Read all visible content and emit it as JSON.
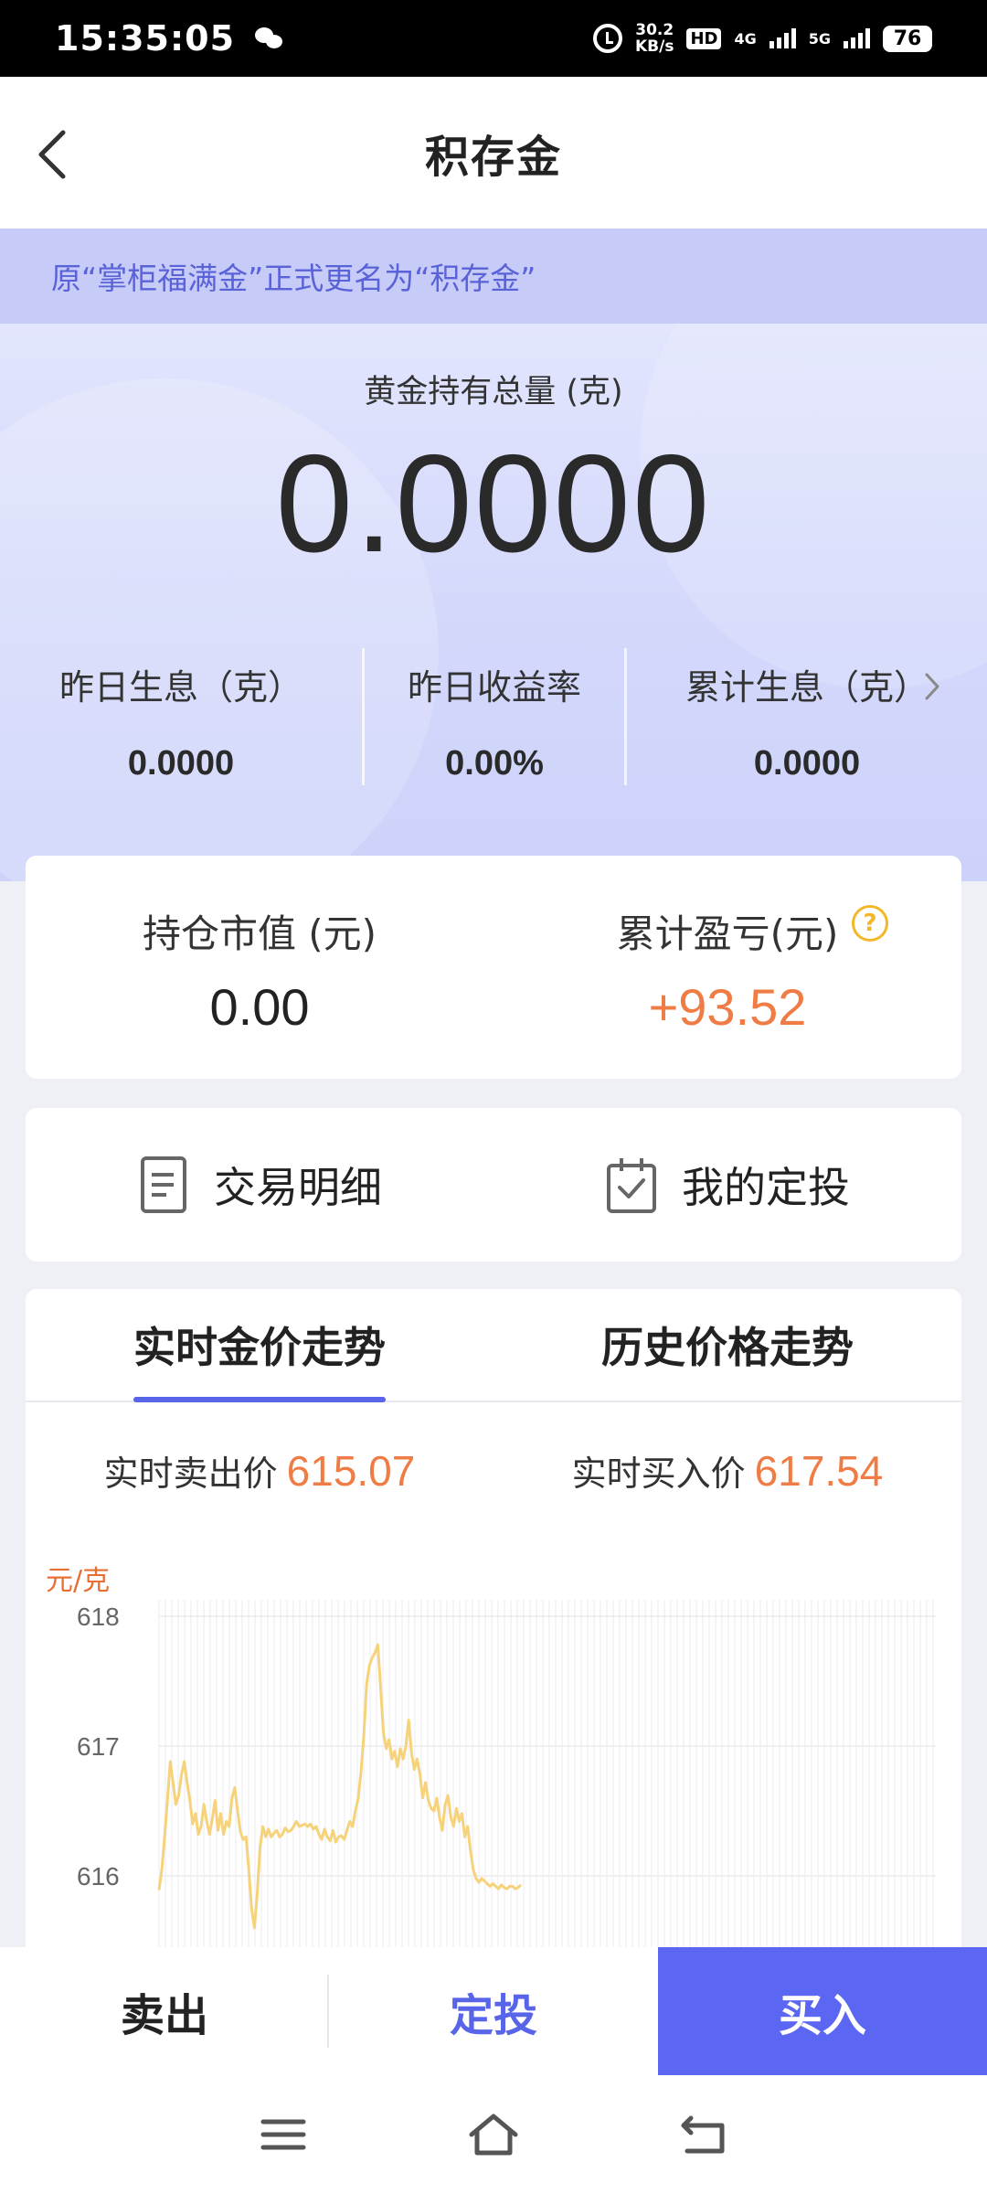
{
  "status_bar": {
    "time": "15:35:05",
    "net_speed_value": "30.2",
    "net_speed_unit": "KB/s",
    "hd_badge": "HD",
    "net_4g": "4G",
    "net_5g": "5G",
    "battery": "76"
  },
  "header": {
    "title": "积存金"
  },
  "notice": {
    "text": "原“掌柜福满金”正式更名为“积存金”"
  },
  "hero": {
    "label": "黄金持有总量 (克)",
    "value": "0.0000",
    "stats": [
      {
        "label": "昨日生息（克）",
        "value": "0.0000"
      },
      {
        "label": "昨日收益率",
        "value": "0.00%"
      },
      {
        "label": "累计生息（克）",
        "value": "0.0000"
      }
    ]
  },
  "value_card": {
    "market_label": "持仓市值 (元)",
    "market_value": "0.00",
    "profit_label": "累计盈亏(元)",
    "profit_value": "+93.52",
    "help_glyph": "?"
  },
  "actions": {
    "details_label": "交易明细",
    "plan_label": "我的定投"
  },
  "chart_section": {
    "tab_realtime": "实时金价走势",
    "tab_history": "历史价格走势",
    "sell_price_label": "实时卖出价",
    "sell_price_value": "615.07",
    "buy_price_label": "实时买入价",
    "buy_price_value": "617.54",
    "unit": "元/克"
  },
  "chart_data": {
    "type": "line",
    "ylabel": "元/克",
    "ylim": [
      615.6,
      618
    ],
    "yticks": [
      "618",
      "617",
      "616"
    ],
    "x": [
      0,
      2,
      4,
      6,
      8,
      10,
      12,
      14,
      16,
      18,
      20,
      22,
      24,
      26,
      28,
      30,
      32,
      34,
      36,
      38,
      40,
      42,
      44,
      46,
      48,
      50,
      52,
      54,
      56,
      58,
      60,
      62,
      64,
      66,
      68,
      70,
      72,
      74,
      76,
      78,
      80,
      82,
      84,
      86,
      88,
      90,
      92,
      94,
      96,
      98,
      100,
      102,
      104,
      106,
      108,
      110,
      112,
      114,
      116,
      118,
      120,
      122,
      124,
      126,
      128,
      130,
      132,
      134,
      136,
      138,
      140,
      142,
      144,
      146,
      148,
      150,
      152,
      154,
      156,
      158,
      160,
      162,
      164,
      166,
      168,
      170,
      172,
      174,
      176,
      178,
      180,
      182,
      184,
      186,
      188,
      190,
      192,
      194,
      196,
      198,
      200,
      202,
      204,
      206,
      208,
      210,
      212,
      214,
      216,
      218,
      220,
      222,
      224,
      226,
      228,
      230,
      232,
      234,
      236,
      238,
      240,
      242,
      244,
      246,
      248,
      250,
      252,
      254,
      256,
      258
    ],
    "series": [
      {
        "color": "#f6d27a",
        "values": [
          615.89,
          616.05,
          616.3,
          616.58,
          616.88,
          616.72,
          616.55,
          616.62,
          616.78,
          616.88,
          616.72,
          616.58,
          616.4,
          616.48,
          616.32,
          616.38,
          616.55,
          616.42,
          616.32,
          616.44,
          616.58,
          616.35,
          616.48,
          616.32,
          616.42,
          616.38,
          616.6,
          616.68,
          616.5,
          616.34,
          616.28,
          616.3,
          616.05,
          615.75,
          615.6,
          615.85,
          616.22,
          616.38,
          616.3,
          616.36,
          616.3,
          616.33,
          616.35,
          616.3,
          616.32,
          616.37,
          616.34,
          616.35,
          616.38,
          616.42,
          616.38,
          616.39,
          616.4,
          616.38,
          616.4,
          616.36,
          616.38,
          616.32,
          616.28,
          616.36,
          616.3,
          616.27,
          616.35,
          616.26,
          616.3,
          616.31,
          616.28,
          616.35,
          616.42,
          616.38,
          616.5,
          616.6,
          616.8,
          617.08,
          617.48,
          617.62,
          617.68,
          617.72,
          617.78,
          617.45,
          617.1,
          616.98,
          617.05,
          616.9,
          616.96,
          616.84,
          616.98,
          616.9,
          617.0,
          617.2,
          616.95,
          616.82,
          616.9,
          616.78,
          616.6,
          616.72,
          616.58,
          616.52,
          616.5,
          616.6,
          616.45,
          616.35,
          616.55,
          616.62,
          616.45,
          616.38,
          616.52,
          616.42,
          616.48,
          616.3,
          616.38,
          616.2,
          616.05,
          615.98,
          615.95,
          615.98,
          615.96,
          615.94,
          615.92,
          615.94,
          615.92,
          615.9,
          615.93,
          615.91,
          615.9,
          615.92,
          615.92,
          615.9,
          615.91,
          615.93
        ]
      }
    ]
  },
  "bottom_bar": {
    "sell_label": "卖出",
    "invest_label": "定投",
    "buy_label": "买入"
  },
  "colors": {
    "accent": "#5b66f2",
    "profit": "#ef7c45",
    "line": "#f6d27a",
    "notice_bg": "#c7cbf7",
    "notice_text": "#5a62d8"
  }
}
